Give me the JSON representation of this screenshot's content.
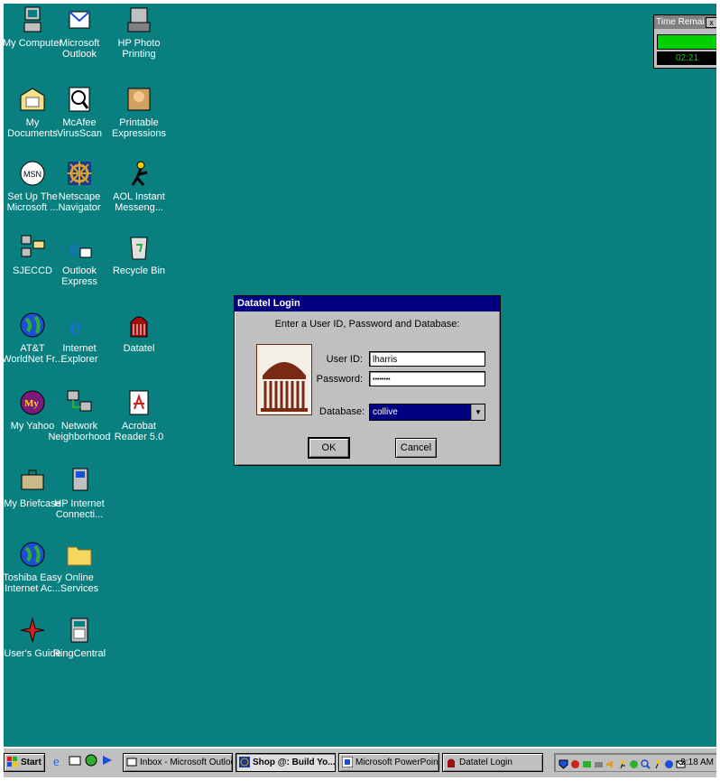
{
  "desktop": {
    "icons": [
      {
        "label": "My Computer",
        "icon": "computer-icon"
      },
      {
        "label": "Microsoft\nOutlook",
        "icon": "outlook-icon"
      },
      {
        "label": "HP Photo\nPrinting",
        "icon": "photo-print-icon"
      },
      {
        "label": "My Documents",
        "icon": "folder-documents-icon"
      },
      {
        "label": "McAfee\nVirusScan",
        "icon": "mcafee-icon"
      },
      {
        "label": "Printable\nExpressions",
        "icon": "printable-expressions-icon"
      },
      {
        "label": "Set Up The\nMicrosoft ...",
        "icon": "msn-icon"
      },
      {
        "label": "Netscape\nNavigator",
        "icon": "netscape-icon"
      },
      {
        "label": "AOL Instant\nMesseng...",
        "icon": "aol-im-icon"
      },
      {
        "label": "SJECCD",
        "icon": "network-drive-icon"
      },
      {
        "label": "Outlook\nExpress",
        "icon": "outlook-express-icon"
      },
      {
        "label": "Recycle Bin",
        "icon": "recycle-bin-icon"
      },
      {
        "label": "AT&T\nWorldNet Fr...",
        "icon": "globe-icon"
      },
      {
        "label": "Internet\nExplorer",
        "icon": "ie-icon"
      },
      {
        "label": "Datatel",
        "icon": "datatel-icon"
      },
      {
        "label": "My Yahoo",
        "icon": "yahoo-icon"
      },
      {
        "label": "Network\nNeighborhood",
        "icon": "network-icon"
      },
      {
        "label": "Acrobat\nReader 5.0",
        "icon": "acrobat-icon"
      },
      {
        "label": "My Briefcase",
        "icon": "briefcase-icon"
      },
      {
        "label": "HP Internet\nConnecti...",
        "icon": "hp-connect-icon"
      },
      {
        "label": "Toshiba Easy\nInternet Ac...",
        "icon": "globe-icon"
      },
      {
        "label": "Online\nServices",
        "icon": "folder-icon"
      },
      {
        "label": "User's Guide",
        "icon": "guide-icon"
      },
      {
        "label": "RingCentral",
        "icon": "fax-icon"
      }
    ]
  },
  "timer": {
    "title": "Time Remai...",
    "close": "x",
    "time": "02:21"
  },
  "dialog": {
    "title": "Datatel Login",
    "prompt": "Enter a User ID, Password and Database:",
    "userid_label": "User ID:",
    "userid_value": "lharris",
    "password_label": "Password:",
    "password_value": "••••••••",
    "database_label": "Database:",
    "database_value": "collive",
    "ok_label": "OK",
    "cancel_label": "Cancel"
  },
  "taskbar": {
    "start_label": "Start",
    "buttons": [
      {
        "label": "Inbox - Microsoft Outlook"
      },
      {
        "label": "Shop @: Build Yo..."
      },
      {
        "label": "Microsoft PowerPoint - ..."
      },
      {
        "label": "Datatel Login"
      }
    ],
    "clock": "9:18 AM"
  },
  "colors": {
    "desktop": "#0a7f7f",
    "titlebar": "#000080"
  }
}
